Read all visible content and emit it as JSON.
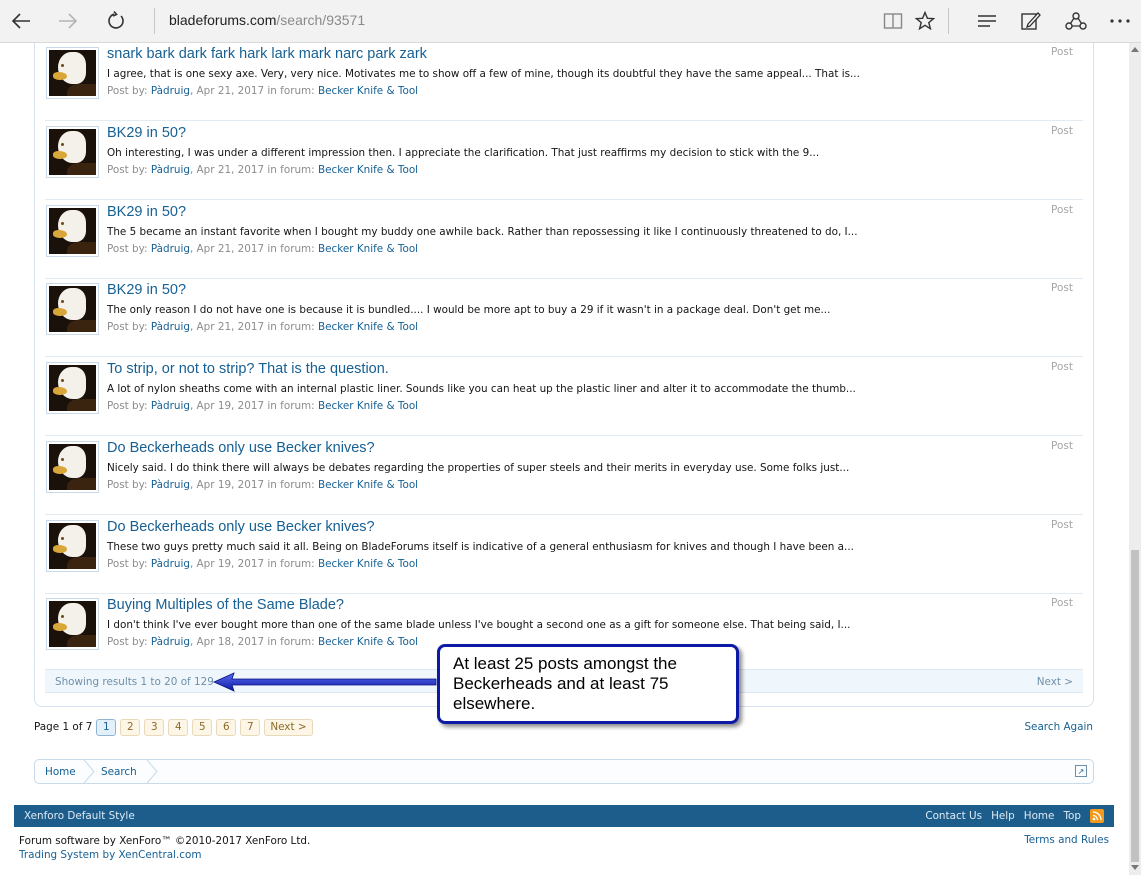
{
  "browser": {
    "url_host": "bladeforums.com",
    "url_path": "/search/93571"
  },
  "results": [
    {
      "title": "snark bark dark fark hark lark mark narc park zark",
      "snippet": "I agree, that is one sexy axe. Very, very nice. Motivates me to show off a few of mine, though its doubtful they have the same appeal... That is...",
      "meta_prefix": "Post by: ",
      "user": "Pàdruig",
      "date": ", Apr 21, 2017 in forum: ",
      "forum": "Becker Knife & Tool",
      "type": "Post"
    },
    {
      "title": "BK29 in 50?",
      "snippet": "Oh interesting, I was under a different impression then. I appreciate the clarification. That just reaffirms my decision to stick with the 9...",
      "meta_prefix": "Post by: ",
      "user": "Pàdruig",
      "date": ", Apr 21, 2017 in forum: ",
      "forum": "Becker Knife & Tool",
      "type": "Post"
    },
    {
      "title": "BK29 in 50?",
      "snippet": "The 5 became an instant favorite when I bought my buddy one awhile back. Rather than repossessing it like I continuously threatened to do, I...",
      "meta_prefix": "Post by: ",
      "user": "Pàdruig",
      "date": ", Apr 21, 2017 in forum: ",
      "forum": "Becker Knife & Tool",
      "type": "Post"
    },
    {
      "title": "BK29 in 50?",
      "snippet": "The only reason I do not have one is because it is bundled.... I would be more apt to buy a 29 if it wasn't in a package deal. Don't get me...",
      "meta_prefix": "Post by: ",
      "user": "Pàdruig",
      "date": ", Apr 21, 2017 in forum: ",
      "forum": "Becker Knife & Tool",
      "type": "Post"
    },
    {
      "title": "To strip, or not to strip? That is the question.",
      "snippet": "A lot of nylon sheaths come with an internal plastic liner. Sounds like you can heat up the plastic liner and alter it to accommodate the thumb...",
      "meta_prefix": "Post by: ",
      "user": "Pàdruig",
      "date": ", Apr 19, 2017 in forum: ",
      "forum": "Becker Knife & Tool",
      "type": "Post"
    },
    {
      "title": "Do Beckerheads only use Becker knives?",
      "snippet": "Nicely said. I do think there will always be debates regarding the properties of super steels and their merits in everyday use. Some folks just...",
      "meta_prefix": "Post by: ",
      "user": "Pàdruig",
      "date": ", Apr 19, 2017 in forum: ",
      "forum": "Becker Knife & Tool",
      "type": "Post"
    },
    {
      "title": "Do Beckerheads only use Becker knives?",
      "snippet": "These two guys pretty much said it all. Being on BladeForums itself is indicative of a general enthusiasm for knives and though I have been a...",
      "meta_prefix": "Post by: ",
      "user": "Pàdruig",
      "date": ", Apr 19, 2017 in forum: ",
      "forum": "Becker Knife & Tool",
      "type": "Post"
    },
    {
      "title": "Buying Multiples of the Same Blade?",
      "snippet": "I don't think I've ever bought more than one of the same blade unless I've bought a second one as a gift for someone else. That being said, I...",
      "meta_prefix": "Post by: ",
      "user": "Pàdruig",
      "date": ", Apr 18, 2017 in forum: ",
      "forum": "Becker Knife & Tool",
      "type": "Post"
    }
  ],
  "pager_bar": {
    "showing": "Showing results 1 to 20 of 129",
    "next": "Next >"
  },
  "pagenav": {
    "label": "Page 1 of 7",
    "pages": [
      "1",
      "2",
      "3",
      "4",
      "5",
      "6",
      "7"
    ],
    "current": "1",
    "next": "Next >"
  },
  "search_again": "Search Again",
  "breadcrumb": [
    "Home",
    "Search"
  ],
  "footer": {
    "style": "Xenforo Default Style",
    "links": [
      "Contact Us",
      "Help",
      "Home",
      "Top"
    ],
    "software": "Forum software by XenForo™ ©2010-2017 XenForo Ltd.",
    "trading": "Trading System by XenCentral.com",
    "terms": "Terms and Rules"
  },
  "annotation": {
    "text": "At least 25 posts amongst the Beckerheads and at least 75 elsewhere."
  },
  "colors": {
    "link": "#176093",
    "footer_bg": "#1c5d8c",
    "callout_border": "#0d1aa6"
  }
}
